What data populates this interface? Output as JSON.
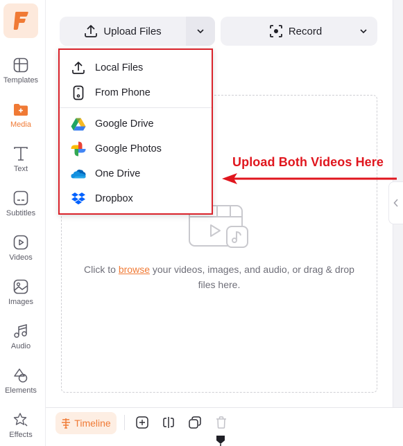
{
  "sidebar": {
    "logo": "F",
    "items": [
      {
        "label": "Templates",
        "icon": "templates-icon",
        "active": false
      },
      {
        "label": "Media",
        "icon": "media-folder-icon",
        "active": true
      },
      {
        "label": "Text",
        "icon": "text-icon",
        "active": false
      },
      {
        "label": "Subtitles",
        "icon": "subtitles-icon",
        "active": false
      },
      {
        "label": "Videos",
        "icon": "video-play-icon",
        "active": false
      },
      {
        "label": "Images",
        "icon": "image-icon",
        "active": false
      },
      {
        "label": "Audio",
        "icon": "music-note-icon",
        "active": false
      },
      {
        "label": "Elements",
        "icon": "shapes-icon",
        "active": false
      },
      {
        "label": "Effects",
        "icon": "star-effects-icon",
        "active": false
      }
    ]
  },
  "toolbar": {
    "upload_label": "Upload Files",
    "record_label": "Record"
  },
  "upload_menu": {
    "items": [
      {
        "label": "Local Files",
        "icon": "upload-icon"
      },
      {
        "label": "From Phone",
        "icon": "phone-icon"
      },
      {
        "label": "Google Drive",
        "icon": "google-drive-icon"
      },
      {
        "label": "Google Photos",
        "icon": "google-photos-icon"
      },
      {
        "label": "One Drive",
        "icon": "onedrive-icon"
      },
      {
        "label": "Dropbox",
        "icon": "dropbox-icon"
      }
    ]
  },
  "dropzone": {
    "text_before": "Click to ",
    "link": "browse",
    "text_after": " your videos, images, and audio, or drag & drop files here."
  },
  "annotation": {
    "text": "Upload Both Videos Here",
    "color": "#e0161e"
  },
  "bottom_bar": {
    "timeline_label": "Timeline"
  },
  "colors": {
    "accent": "#f07a35",
    "annotation_red": "#d9222a"
  }
}
